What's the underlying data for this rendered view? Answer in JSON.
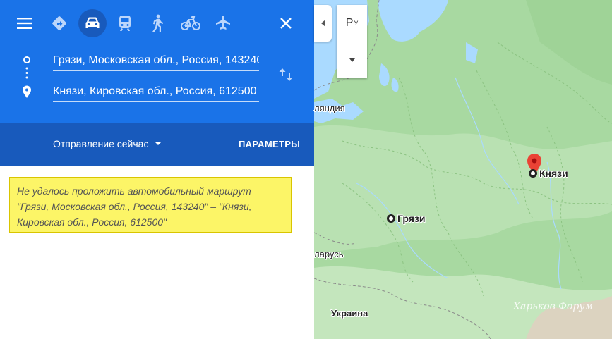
{
  "travel_modes": [
    {
      "name": "best",
      "icon": "directions-diamond-icon",
      "active": false
    },
    {
      "name": "driving",
      "icon": "car-icon",
      "active": true
    },
    {
      "name": "transit",
      "icon": "train-icon",
      "active": false
    },
    {
      "name": "walking",
      "icon": "walk-icon",
      "active": false
    },
    {
      "name": "cycling",
      "icon": "bike-icon",
      "active": false
    },
    {
      "name": "flights",
      "icon": "plane-icon",
      "active": false
    }
  ],
  "route": {
    "start_value": "Грязи, Московская обл., Россия, 143240",
    "end_value": "Князи, Кировская обл., Россия, 612500"
  },
  "options": {
    "depart_label": "Отправление сейчас",
    "params_label": "ПАРАМЕТРЫ"
  },
  "error_message": "Не удалось проложить автомобильный маршрут \"Грязи, Московская обл., Россия, 143240\"  – \"Князи, Кировская обл., Россия, 612500\"",
  "map": {
    "layer_label": "Р",
    "layer_sub": "У",
    "labels": {
      "finland": "ляндия",
      "belarus": "ларусь",
      "ukraine": "Украина",
      "start_city": "Грязи",
      "end_city": "Князи",
      "watermark": "Харьков Форум"
    }
  },
  "colors": {
    "header_blue": "#1a73e8",
    "subheader_blue": "#185abc",
    "error_yellow": "#fcf567",
    "map_green": "#a8d9a1",
    "water": "#aadaff",
    "pin_red": "#ea4335"
  }
}
